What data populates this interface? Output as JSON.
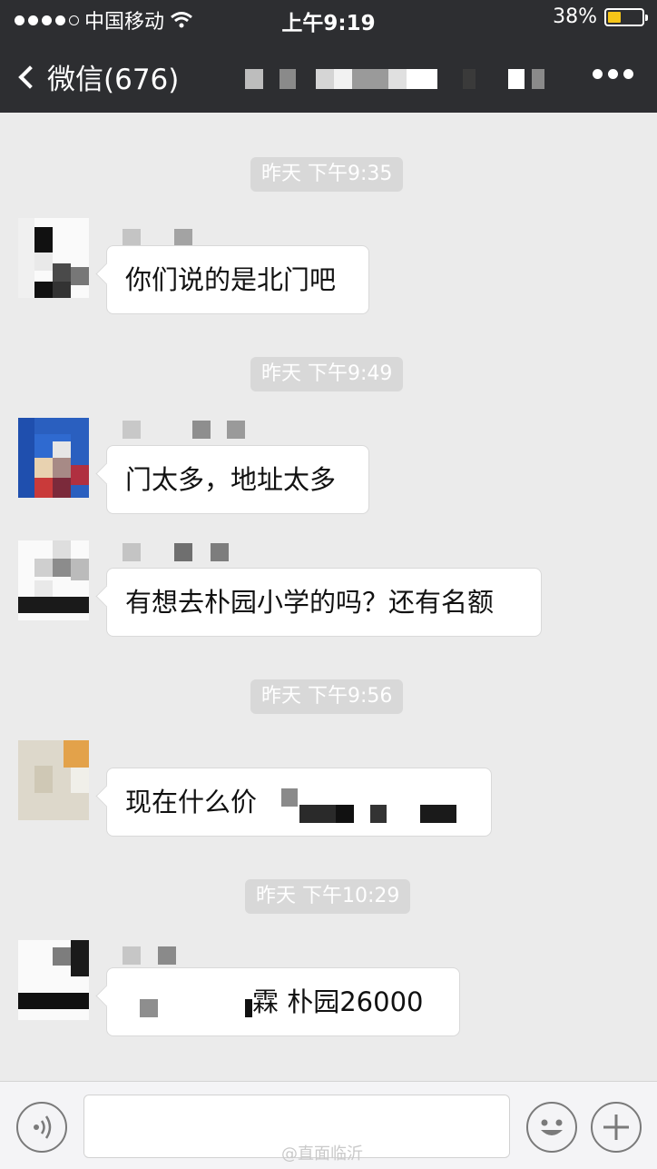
{
  "status_bar": {
    "carrier": "中国移动",
    "time": "上午9:19",
    "battery": "38%",
    "battery_level": 0.38
  },
  "nav": {
    "back_label": "微信(676)"
  },
  "messages": [
    {
      "timestamp": "昨天 下午9:35",
      "text": "你们说的是北门吧"
    },
    {
      "timestamp": "昨天 下午9:49",
      "text": "门太多，地址太多"
    },
    {
      "timestamp": "",
      "text": "有想去朴园小学的吗？还有名额"
    },
    {
      "timestamp": "昨天 下午9:56",
      "text": "现在什么价"
    },
    {
      "timestamp": "昨天 下午10:29",
      "text": "霖 朴园26000"
    }
  ],
  "watermark": "@直面临沂",
  "colors": {
    "top_bar": "#2d2e31",
    "chat_background": "#ebebeb",
    "battery_fill": "#f5c518"
  },
  "icons": {
    "back": "chevron-left-icon",
    "more": "more-dots-icon",
    "voice": "voice-icon",
    "emoji": "emoji-icon",
    "add": "plus-icon"
  }
}
